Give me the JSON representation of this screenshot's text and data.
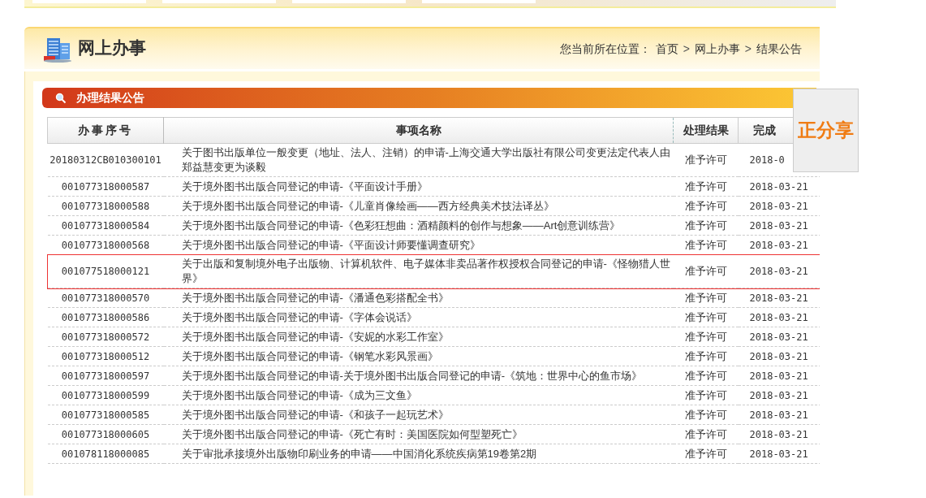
{
  "header": {
    "title": "网上办事",
    "breadcrumb_label": "您当前所在位置：",
    "breadcrumb": [
      {
        "label": "首页"
      },
      {
        "label": "网上办事"
      },
      {
        "label": "结果公告"
      }
    ],
    "separator": ">"
  },
  "section": {
    "title": "办理结果公告"
  },
  "table": {
    "columns": [
      "办事序号",
      "事项名称",
      "处理结果",
      "完成"
    ],
    "rows": [
      {
        "id": "20180312CB010300101",
        "name": "关于图书出版单位一般变更（地址、法人、注销）的申请-上海交通大学出版社有限公司变更法定代表人由郑益慧变更为谈毅",
        "result": "准予许可",
        "date": "2018-0",
        "selected": false
      },
      {
        "id": "001077318000587",
        "name": "关于境外图书出版合同登记的申请-《平面设计手册》",
        "result": "准予许可",
        "date": "2018-03-21",
        "selected": false
      },
      {
        "id": "001077318000588",
        "name": "关于境外图书出版合同登记的申请-《儿童肖像绘画——西方经典美术技法译丛》",
        "result": "准予许可",
        "date": "2018-03-21",
        "selected": false
      },
      {
        "id": "001077318000584",
        "name": "关于境外图书出版合同登记的申请-《色彩狂想曲：酒精颜料的创作与想象——Art创意训练营》",
        "result": "准予许可",
        "date": "2018-03-21",
        "selected": false
      },
      {
        "id": "001077318000568",
        "name": "关于境外图书出版合同登记的申请-《平面设计师要懂调查研究》",
        "result": "准予许可",
        "date": "2018-03-21",
        "selected": false
      },
      {
        "id": "001077518000121",
        "name": "关于出版和复制境外电子出版物、计算机软件、电子媒体非卖品著作权授权合同登记的申请-《怪物猎人世界》",
        "result": "准予许可",
        "date": "2018-03-21",
        "selected": true
      },
      {
        "id": "001077318000570",
        "name": "关于境外图书出版合同登记的申请-《潘通色彩搭配全书》",
        "result": "准予许可",
        "date": "2018-03-21",
        "selected": false
      },
      {
        "id": "001077318000586",
        "name": "关于境外图书出版合同登记的申请-《字体会说话》",
        "result": "准予许可",
        "date": "2018-03-21",
        "selected": false
      },
      {
        "id": "001077318000572",
        "name": "关于境外图书出版合同登记的申请-《安妮的水彩工作室》",
        "result": "准予许可",
        "date": "2018-03-21",
        "selected": false
      },
      {
        "id": "001077318000512",
        "name": "关于境外图书出版合同登记的申请-《钢笔水彩风景画》",
        "result": "准予许可",
        "date": "2018-03-21",
        "selected": false
      },
      {
        "id": "001077318000597",
        "name": "关于境外图书出版合同登记的申请-关于境外图书出版合同登记的申请-《筑地：世界中心的鱼市场》",
        "result": "准予许可",
        "date": "2018-03-21",
        "selected": false
      },
      {
        "id": "001077318000599",
        "name": "关于境外图书出版合同登记的申请-《成为三文鱼》",
        "result": "准予许可",
        "date": "2018-03-21",
        "selected": false
      },
      {
        "id": "001077318000585",
        "name": "关于境外图书出版合同登记的申请-《和孩子一起玩艺术》",
        "result": "准予许可",
        "date": "2018-03-21",
        "selected": false
      },
      {
        "id": "001077318000605",
        "name": "关于境外图书出版合同登记的申请-《死亡有时：美国医院如何型塑死亡》",
        "result": "准予许可",
        "date": "2018-03-21",
        "selected": false
      },
      {
        "id": "001078118000085",
        "name": "关于审批承接境外出版物印刷业务的申请——中国消化系统疾病第19卷第2期",
        "result": "准予许可",
        "date": "2018-03-21",
        "selected": false
      }
    ]
  },
  "share": {
    "label": "正分享"
  }
}
